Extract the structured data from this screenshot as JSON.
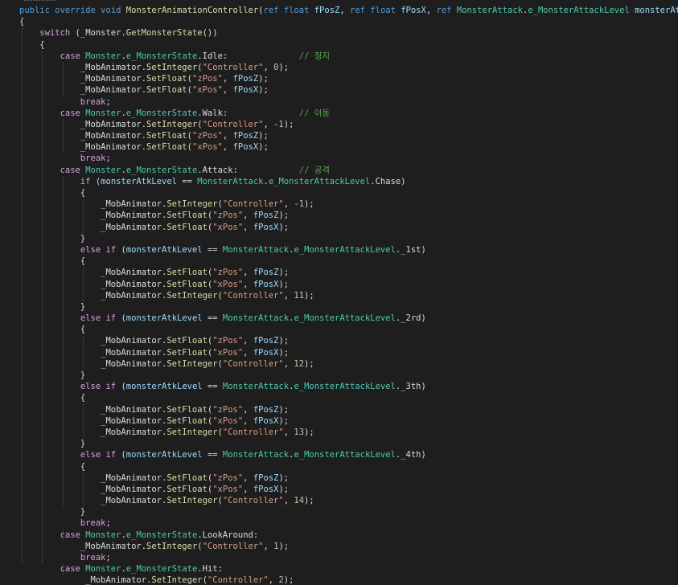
{
  "editor": {
    "lines": [
      [
        {
          "t": "public",
          "c": "kw"
        },
        {
          "t": " "
        },
        {
          "t": "override",
          "c": "kw"
        },
        {
          "t": " "
        },
        {
          "t": "void",
          "c": "kw"
        },
        {
          "t": " "
        },
        {
          "t": "MonsterAnimationController",
          "c": "fn"
        },
        {
          "t": "("
        },
        {
          "t": "ref",
          "c": "kw"
        },
        {
          "t": " "
        },
        {
          "t": "float",
          "c": "kw"
        },
        {
          "t": " "
        },
        {
          "t": "fPosZ",
          "c": "param"
        },
        {
          "t": ", "
        },
        {
          "t": "ref",
          "c": "kw"
        },
        {
          "t": " "
        },
        {
          "t": "float",
          "c": "kw"
        },
        {
          "t": " "
        },
        {
          "t": "fPosX",
          "c": "param"
        },
        {
          "t": ", "
        },
        {
          "t": "ref",
          "c": "kw"
        },
        {
          "t": " "
        },
        {
          "t": "MonsterAttack",
          "c": "ty"
        },
        {
          "t": "."
        },
        {
          "t": "e_MonsterAttackLevel",
          "c": "ty"
        },
        {
          "t": " "
        },
        {
          "t": "monsterAtkLevel",
          "c": "param"
        },
        {
          "t": ")"
        }
      ],
      [
        {
          "t": "{"
        }
      ],
      [
        {
          "t": "    "
        },
        {
          "t": "switch",
          "c": "ctl"
        },
        {
          "t": " (_Monster."
        },
        {
          "t": "GetMonsterState",
          "c": "fn"
        },
        {
          "t": "())"
        }
      ],
      [
        {
          "t": "    {"
        }
      ],
      [
        {
          "t": "        "
        },
        {
          "t": "case",
          "c": "ctl"
        },
        {
          "t": " "
        },
        {
          "t": "Monster",
          "c": "ty"
        },
        {
          "t": "."
        },
        {
          "t": "e_MonsterState",
          "c": "ty"
        },
        {
          "t": ".Idle:              "
        },
        {
          "t": "// 정지",
          "c": "cm"
        }
      ],
      [
        {
          "t": "            _MobAnimator."
        },
        {
          "t": "SetInteger",
          "c": "fn"
        },
        {
          "t": "("
        },
        {
          "t": "\"Controller\"",
          "c": "str"
        },
        {
          "t": ", "
        },
        {
          "t": "0",
          "c": "num"
        },
        {
          "t": ");"
        }
      ],
      [
        {
          "t": "            _MobAnimator."
        },
        {
          "t": "SetFloat",
          "c": "fn"
        },
        {
          "t": "("
        },
        {
          "t": "\"zPos\"",
          "c": "str"
        },
        {
          "t": ", "
        },
        {
          "t": "fPosZ",
          "c": "param"
        },
        {
          "t": ");"
        }
      ],
      [
        {
          "t": "            _MobAnimator."
        },
        {
          "t": "SetFloat",
          "c": "fn"
        },
        {
          "t": "("
        },
        {
          "t": "\"xPos\"",
          "c": "str"
        },
        {
          "t": ", "
        },
        {
          "t": "fPosX",
          "c": "param"
        },
        {
          "t": ");"
        }
      ],
      [
        {
          "t": "            "
        },
        {
          "t": "break",
          "c": "ctl"
        },
        {
          "t": ";"
        }
      ],
      [
        {
          "t": "        "
        },
        {
          "t": "case",
          "c": "ctl"
        },
        {
          "t": " "
        },
        {
          "t": "Monster",
          "c": "ty"
        },
        {
          "t": "."
        },
        {
          "t": "e_MonsterState",
          "c": "ty"
        },
        {
          "t": ".Walk:              "
        },
        {
          "t": "// 이동",
          "c": "cm"
        }
      ],
      [
        {
          "t": "            _MobAnimator."
        },
        {
          "t": "SetInteger",
          "c": "fn"
        },
        {
          "t": "("
        },
        {
          "t": "\"Controller\"",
          "c": "str"
        },
        {
          "t": ", "
        },
        {
          "t": "-1",
          "c": "num"
        },
        {
          "t": ");"
        }
      ],
      [
        {
          "t": "            _MobAnimator."
        },
        {
          "t": "SetFloat",
          "c": "fn"
        },
        {
          "t": "("
        },
        {
          "t": "\"zPos\"",
          "c": "str"
        },
        {
          "t": ", "
        },
        {
          "t": "fPosZ",
          "c": "param"
        },
        {
          "t": ");"
        }
      ],
      [
        {
          "t": "            _MobAnimator."
        },
        {
          "t": "SetFloat",
          "c": "fn"
        },
        {
          "t": "("
        },
        {
          "t": "\"xPos\"",
          "c": "str"
        },
        {
          "t": ", "
        },
        {
          "t": "fPosX",
          "c": "param"
        },
        {
          "t": ");"
        }
      ],
      [
        {
          "t": "            "
        },
        {
          "t": "break",
          "c": "ctl"
        },
        {
          "t": ";"
        }
      ],
      [
        {
          "t": "        "
        },
        {
          "t": "case",
          "c": "ctl"
        },
        {
          "t": " "
        },
        {
          "t": "Monster",
          "c": "ty"
        },
        {
          "t": "."
        },
        {
          "t": "e_MonsterState",
          "c": "ty"
        },
        {
          "t": ".Attack:            "
        },
        {
          "t": "// 공격",
          "c": "cm"
        }
      ],
      [
        {
          "t": "            "
        },
        {
          "t": "if",
          "c": "ctl"
        },
        {
          "t": " ("
        },
        {
          "t": "monsterAtkLevel",
          "c": "param"
        },
        {
          "t": " == "
        },
        {
          "t": "MonsterAttack",
          "c": "ty"
        },
        {
          "t": "."
        },
        {
          "t": "e_MonsterAttackLevel",
          "c": "ty"
        },
        {
          "t": ".Chase)"
        }
      ],
      [
        {
          "t": "            {"
        }
      ],
      [
        {
          "t": "                _MobAnimator."
        },
        {
          "t": "SetInteger",
          "c": "fn"
        },
        {
          "t": "("
        },
        {
          "t": "\"Controller\"",
          "c": "str"
        },
        {
          "t": ", "
        },
        {
          "t": "-1",
          "c": "num"
        },
        {
          "t": ");"
        }
      ],
      [
        {
          "t": "                _MobAnimator."
        },
        {
          "t": "SetFloat",
          "c": "fn"
        },
        {
          "t": "("
        },
        {
          "t": "\"zPos\"",
          "c": "str"
        },
        {
          "t": ", "
        },
        {
          "t": "fPosZ",
          "c": "param"
        },
        {
          "t": ");"
        }
      ],
      [
        {
          "t": "                _MobAnimator."
        },
        {
          "t": "SetFloat",
          "c": "fn"
        },
        {
          "t": "("
        },
        {
          "t": "\"xPos\"",
          "c": "str"
        },
        {
          "t": ", "
        },
        {
          "t": "fPosX",
          "c": "param"
        },
        {
          "t": ");"
        }
      ],
      [
        {
          "t": "            }"
        }
      ],
      [
        {
          "t": "            "
        },
        {
          "t": "else",
          "c": "ctl"
        },
        {
          "t": " "
        },
        {
          "t": "if",
          "c": "ctl"
        },
        {
          "t": " ("
        },
        {
          "t": "monsterAtkLevel",
          "c": "param"
        },
        {
          "t": " == "
        },
        {
          "t": "MonsterAttack",
          "c": "ty"
        },
        {
          "t": "."
        },
        {
          "t": "e_MonsterAttackLevel",
          "c": "ty"
        },
        {
          "t": "._1st)"
        }
      ],
      [
        {
          "t": "            {"
        }
      ],
      [
        {
          "t": "                _MobAnimator."
        },
        {
          "t": "SetFloat",
          "c": "fn"
        },
        {
          "t": "("
        },
        {
          "t": "\"zPos\"",
          "c": "str"
        },
        {
          "t": ", "
        },
        {
          "t": "fPosZ",
          "c": "param"
        },
        {
          "t": ");"
        }
      ],
      [
        {
          "t": "                _MobAnimator."
        },
        {
          "t": "SetFloat",
          "c": "fn"
        },
        {
          "t": "("
        },
        {
          "t": "\"xPos\"",
          "c": "str"
        },
        {
          "t": ", "
        },
        {
          "t": "fPosX",
          "c": "param"
        },
        {
          "t": ");"
        }
      ],
      [
        {
          "t": "                _MobAnimator."
        },
        {
          "t": "SetInteger",
          "c": "fn"
        },
        {
          "t": "("
        },
        {
          "t": "\"Controller\"",
          "c": "str"
        },
        {
          "t": ", "
        },
        {
          "t": "11",
          "c": "num"
        },
        {
          "t": ");"
        }
      ],
      [
        {
          "t": "            }"
        }
      ],
      [
        {
          "t": "            "
        },
        {
          "t": "else",
          "c": "ctl"
        },
        {
          "t": " "
        },
        {
          "t": "if",
          "c": "ctl"
        },
        {
          "t": " ("
        },
        {
          "t": "monsterAtkLevel",
          "c": "param"
        },
        {
          "t": " == "
        },
        {
          "t": "MonsterAttack",
          "c": "ty"
        },
        {
          "t": "."
        },
        {
          "t": "e_MonsterAttackLevel",
          "c": "ty"
        },
        {
          "t": "._2rd)"
        }
      ],
      [
        {
          "t": "            {"
        }
      ],
      [
        {
          "t": "                _MobAnimator."
        },
        {
          "t": "SetFloat",
          "c": "fn"
        },
        {
          "t": "("
        },
        {
          "t": "\"zPos\"",
          "c": "str"
        },
        {
          "t": ", "
        },
        {
          "t": "fPosZ",
          "c": "param"
        },
        {
          "t": ");"
        }
      ],
      [
        {
          "t": "                _MobAnimator."
        },
        {
          "t": "SetFloat",
          "c": "fn"
        },
        {
          "t": "("
        },
        {
          "t": "\"xPos\"",
          "c": "str"
        },
        {
          "t": ", "
        },
        {
          "t": "fPosX",
          "c": "param"
        },
        {
          "t": ");"
        }
      ],
      [
        {
          "t": "                _MobAnimator."
        },
        {
          "t": "SetInteger",
          "c": "fn"
        },
        {
          "t": "("
        },
        {
          "t": "\"Controller\"",
          "c": "str"
        },
        {
          "t": ", "
        },
        {
          "t": "12",
          "c": "num"
        },
        {
          "t": ");"
        }
      ],
      [
        {
          "t": "            }"
        }
      ],
      [
        {
          "t": "            "
        },
        {
          "t": "else",
          "c": "ctl"
        },
        {
          "t": " "
        },
        {
          "t": "if",
          "c": "ctl"
        },
        {
          "t": " ("
        },
        {
          "t": "monsterAtkLevel",
          "c": "param"
        },
        {
          "t": " == "
        },
        {
          "t": "MonsterAttack",
          "c": "ty"
        },
        {
          "t": "."
        },
        {
          "t": "e_MonsterAttackLevel",
          "c": "ty"
        },
        {
          "t": "._3th)"
        }
      ],
      [
        {
          "t": "            {"
        }
      ],
      [
        {
          "t": "                _MobAnimator."
        },
        {
          "t": "SetFloat",
          "c": "fn"
        },
        {
          "t": "("
        },
        {
          "t": "\"zPos\"",
          "c": "str"
        },
        {
          "t": ", "
        },
        {
          "t": "fPosZ",
          "c": "param"
        },
        {
          "t": ");"
        }
      ],
      [
        {
          "t": "                _MobAnimator."
        },
        {
          "t": "SetFloat",
          "c": "fn"
        },
        {
          "t": "("
        },
        {
          "t": "\"xPos\"",
          "c": "str"
        },
        {
          "t": ", "
        },
        {
          "t": "fPosX",
          "c": "param"
        },
        {
          "t": ");"
        }
      ],
      [
        {
          "t": "                _MobAnimator."
        },
        {
          "t": "SetInteger",
          "c": "fn"
        },
        {
          "t": "("
        },
        {
          "t": "\"Controller\"",
          "c": "str"
        },
        {
          "t": ", "
        },
        {
          "t": "13",
          "c": "num"
        },
        {
          "t": ");"
        }
      ],
      [
        {
          "t": "            }"
        }
      ],
      [
        {
          "t": "            "
        },
        {
          "t": "else",
          "c": "ctl"
        },
        {
          "t": " "
        },
        {
          "t": "if",
          "c": "ctl"
        },
        {
          "t": " ("
        },
        {
          "t": "monsterAtkLevel",
          "c": "param"
        },
        {
          "t": " == "
        },
        {
          "t": "MonsterAttack",
          "c": "ty"
        },
        {
          "t": "."
        },
        {
          "t": "e_MonsterAttackLevel",
          "c": "ty"
        },
        {
          "t": "._4th)"
        }
      ],
      [
        {
          "t": "            {"
        }
      ],
      [
        {
          "t": "                _MobAnimator."
        },
        {
          "t": "SetFloat",
          "c": "fn"
        },
        {
          "t": "("
        },
        {
          "t": "\"zPos\"",
          "c": "str"
        },
        {
          "t": ", "
        },
        {
          "t": "fPosZ",
          "c": "param"
        },
        {
          "t": ");"
        }
      ],
      [
        {
          "t": "                _MobAnimator."
        },
        {
          "t": "SetFloat",
          "c": "fn"
        },
        {
          "t": "("
        },
        {
          "t": "\"xPos\"",
          "c": "str"
        },
        {
          "t": ", "
        },
        {
          "t": "fPosX",
          "c": "param"
        },
        {
          "t": ");"
        }
      ],
      [
        {
          "t": "                _MobAnimator."
        },
        {
          "t": "SetInteger",
          "c": "fn"
        },
        {
          "t": "("
        },
        {
          "t": "\"Controller\"",
          "c": "str"
        },
        {
          "t": ", "
        },
        {
          "t": "14",
          "c": "num"
        },
        {
          "t": ");"
        }
      ],
      [
        {
          "t": "            }"
        }
      ],
      [
        {
          "t": "            "
        },
        {
          "t": "break",
          "c": "ctl"
        },
        {
          "t": ";"
        }
      ],
      [
        {
          "t": "        "
        },
        {
          "t": "case",
          "c": "ctl"
        },
        {
          "t": " "
        },
        {
          "t": "Monster",
          "c": "ty"
        },
        {
          "t": "."
        },
        {
          "t": "e_MonsterState",
          "c": "ty"
        },
        {
          "t": ".LookAround:"
        }
      ],
      [
        {
          "t": "            _MobAnimator."
        },
        {
          "t": "SetInteger",
          "c": "fn"
        },
        {
          "t": "("
        },
        {
          "t": "\"Controller\"",
          "c": "str"
        },
        {
          "t": ", "
        },
        {
          "t": "1",
          "c": "num"
        },
        {
          "t": ");"
        }
      ],
      [
        {
          "t": "            "
        },
        {
          "t": "break",
          "c": "ctl"
        },
        {
          "t": ";"
        }
      ],
      [
        {
          "t": "        "
        },
        {
          "t": "case",
          "c": "ctl"
        },
        {
          "t": " "
        },
        {
          "t": "Monster",
          "c": "ty"
        },
        {
          "t": "."
        },
        {
          "t": "e_MonsterState",
          "c": "ty"
        },
        {
          "t": ".Hit:"
        }
      ],
      [
        {
          "t": "             _MobAnimator."
        },
        {
          "t": "SetInteger",
          "c": "fn"
        },
        {
          "t": "("
        },
        {
          "t": "\"Controller\"",
          "c": "str"
        },
        {
          "t": ", "
        },
        {
          "t": "2",
          "c": "num"
        },
        {
          "t": ");"
        }
      ]
    ]
  }
}
